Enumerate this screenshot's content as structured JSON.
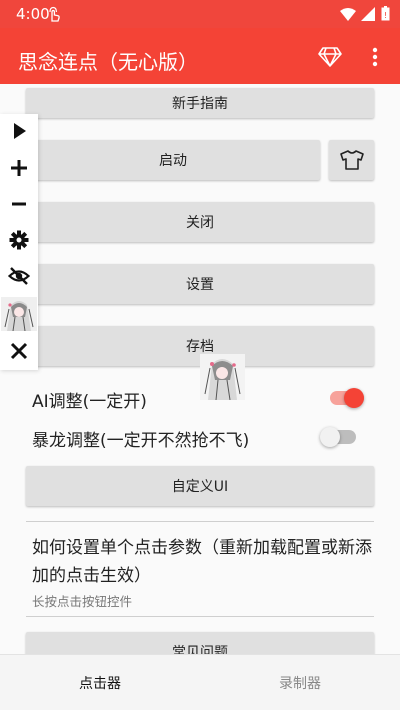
{
  "status_bar": {
    "time": "4:00"
  },
  "app_bar": {
    "title": "思念连点（无心版）"
  },
  "buttons": {
    "guide": "新手指南",
    "start": "启动",
    "close": "关闭",
    "settings": "设置",
    "save": "存档",
    "custom_ui": "自定义UI",
    "faq": "常见问题"
  },
  "switches": {
    "ai": {
      "label": "AI调整(一定开)",
      "on": true
    },
    "dragon": {
      "label": "暴龙调整(一定开不然抢不飞)",
      "on": false
    }
  },
  "info": {
    "title": "如何设置单个点击参数（重新加载配置或新添加的点击生效）",
    "subtitle": "长按点击按钮控件"
  },
  "bottom_nav": {
    "clicker": "点击器",
    "recorder": "录制器"
  },
  "float_toolbar": {
    "icons": [
      "play-icon",
      "plus-icon",
      "minus-icon",
      "gear-icon",
      "eye-off-icon",
      "avatar-thumbnail",
      "close-icon"
    ]
  },
  "colors": {
    "accent": "#f44336",
    "status_bar": "#f0463c",
    "switch_on": "#f44336"
  }
}
